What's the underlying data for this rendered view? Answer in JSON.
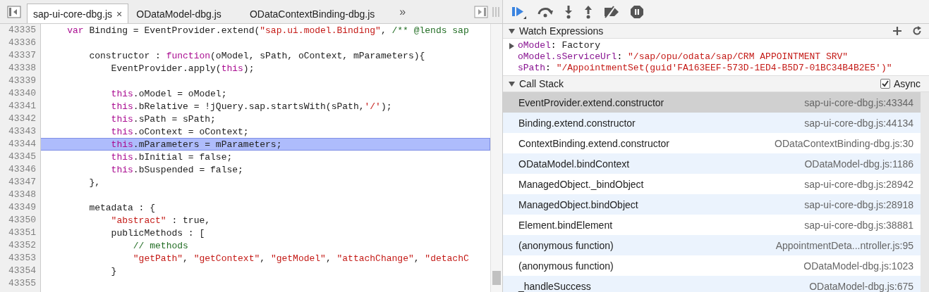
{
  "tabs": [
    {
      "label": "sap-ui-core-dbg.js",
      "selected": true,
      "close": "×"
    },
    {
      "label": "ODataModel-dbg.js",
      "selected": false
    },
    {
      "label": "ODataContextBinding-dbg.js",
      "selected": false
    }
  ],
  "tabs_overflow": "»",
  "code": {
    "lines": [
      {
        "number": "43335",
        "highlighted": false,
        "tokens": [
          {
            "kind": "keyword",
            "text": "    var"
          },
          {
            "kind": "plain",
            "text": " Binding = EventProvider.extend("
          },
          {
            "kind": "string",
            "text": "\"sap.ui.model.Binding\""
          },
          {
            "kind": "plain",
            "text": ", "
          },
          {
            "kind": "comment",
            "text": "/** @lends sap"
          }
        ]
      },
      {
        "number": "43336",
        "highlighted": false
      },
      {
        "number": "43337",
        "highlighted": false,
        "tokens": [
          {
            "kind": "plain",
            "text": "        constructor : "
          },
          {
            "kind": "keyword",
            "text": "function"
          },
          {
            "kind": "plain",
            "text": "(oModel, sPath, oContext, mParameters){"
          }
        ]
      },
      {
        "number": "43338",
        "highlighted": false,
        "tokens": [
          {
            "kind": "plain",
            "text": "            EventProvider.apply("
          },
          {
            "kind": "keyword",
            "text": "this"
          },
          {
            "kind": "plain",
            "text": ");"
          }
        ]
      },
      {
        "number": "43339",
        "highlighted": false
      },
      {
        "number": "43340",
        "highlighted": false,
        "tokens": [
          {
            "kind": "keyword",
            "text": "            this"
          },
          {
            "kind": "plain",
            "text": ".oModel = oModel;"
          }
        ]
      },
      {
        "number": "43341",
        "highlighted": false,
        "tokens": [
          {
            "kind": "keyword",
            "text": "            this"
          },
          {
            "kind": "plain",
            "text": ".bRelative = !jQuery.sap.startsWith(sPath,"
          },
          {
            "kind": "string",
            "text": "'/'"
          },
          {
            "kind": "plain",
            "text": ");"
          }
        ]
      },
      {
        "number": "43342",
        "highlighted": false,
        "tokens": [
          {
            "kind": "keyword",
            "text": "            this"
          },
          {
            "kind": "plain",
            "text": ".sPath = sPath;"
          }
        ]
      },
      {
        "number": "43343",
        "highlighted": false,
        "tokens": [
          {
            "kind": "keyword",
            "text": "            this"
          },
          {
            "kind": "plain",
            "text": ".oContext = oContext;"
          }
        ]
      },
      {
        "number": "43344",
        "highlighted": true,
        "tokens": [
          {
            "kind": "keyword",
            "text": "            this"
          },
          {
            "kind": "plain",
            "text": ".mParameters = mParameters;"
          }
        ]
      },
      {
        "number": "43345",
        "highlighted": false,
        "tokens": [
          {
            "kind": "keyword",
            "text": "            this"
          },
          {
            "kind": "plain",
            "text": ".bInitial = false;"
          }
        ]
      },
      {
        "number": "43346",
        "highlighted": false,
        "tokens": [
          {
            "kind": "keyword",
            "text": "            this"
          },
          {
            "kind": "plain",
            "text": ".bSuspended = false;"
          }
        ]
      },
      {
        "number": "43347",
        "highlighted": false,
        "tokens": [
          {
            "kind": "plain",
            "text": "        },"
          }
        ]
      },
      {
        "number": "43348",
        "highlighted": false
      },
      {
        "number": "43349",
        "highlighted": false,
        "tokens": [
          {
            "kind": "plain",
            "text": "        metadata : {"
          }
        ]
      },
      {
        "number": "43350",
        "highlighted": false,
        "tokens": [
          {
            "kind": "string",
            "text": "            \"abstract\""
          },
          {
            "kind": "plain",
            "text": " : true,"
          }
        ]
      },
      {
        "number": "43351",
        "highlighted": false,
        "tokens": [
          {
            "kind": "plain",
            "text": "            publicMethods : ["
          }
        ]
      },
      {
        "number": "43352",
        "highlighted": false,
        "tokens": [
          {
            "kind": "comment",
            "text": "                // methods"
          }
        ]
      },
      {
        "number": "43353",
        "highlighted": false,
        "tokens": [
          {
            "kind": "string",
            "text": "                \"getPath\""
          },
          {
            "kind": "plain",
            "text": ", "
          },
          {
            "kind": "string",
            "text": "\"getContext\""
          },
          {
            "kind": "plain",
            "text": ", "
          },
          {
            "kind": "string",
            "text": "\"getModel\""
          },
          {
            "kind": "plain",
            "text": ", "
          },
          {
            "kind": "string",
            "text": "\"attachChange\""
          },
          {
            "kind": "plain",
            "text": ", "
          },
          {
            "kind": "string",
            "text": "\"detachC"
          }
        ]
      },
      {
        "number": "43354",
        "highlighted": false,
        "tokens": [
          {
            "kind": "plain",
            "text": "            }"
          }
        ]
      },
      {
        "number": "43355",
        "highlighted": false
      }
    ]
  },
  "watch": {
    "title": "Watch Expressions",
    "expanded": true,
    "items": [
      {
        "name": "oModel",
        "separator": ":",
        "value": "Factory",
        "kind": "object",
        "expanded": false
      },
      {
        "name": "oModel.sServiceUrl",
        "separator": ":",
        "value": "\"/sap/opu/odata/sap/CRM APPOINTMENT SRV\"",
        "kind": "string"
      },
      {
        "name": "sPath",
        "separator": ":",
        "value": "\"/AppointmentSet(guid'FA163EEF-573D-1ED4-B5D7-01BC34B4B2E5')\"",
        "kind": "string"
      }
    ]
  },
  "call_stack": {
    "title": "Call Stack",
    "expanded": true,
    "async": {
      "label": "Async",
      "checked": true
    },
    "frames": [
      {
        "function": "EventProvider.extend.constructor",
        "location": "sap-ui-core-dbg.js:43344",
        "selected": true
      },
      {
        "function": "Binding.extend.constructor",
        "location": "sap-ui-core-dbg.js:44134",
        "selected": false
      },
      {
        "function": "ContextBinding.extend.constructor",
        "location": "ODataContextBinding-dbg.js:30",
        "selected": false
      },
      {
        "function": "ODataModel.bindContext",
        "location": "ODataModel-dbg.js:1186",
        "selected": false
      },
      {
        "function": "ManagedObject._bindObject",
        "location": "sap-ui-core-dbg.js:28942",
        "selected": false
      },
      {
        "function": "ManagedObject.bindObject",
        "location": "sap-ui-core-dbg.js:28918",
        "selected": false
      },
      {
        "function": "Element.bindElement",
        "location": "sap-ui-core-dbg.js:38881",
        "selected": false
      },
      {
        "function": "(anonymous function)",
        "location": "AppointmentDeta...ntroller.js:95",
        "selected": false
      },
      {
        "function": "(anonymous function)",
        "location": "ODataModel-dbg.js:1023",
        "selected": false
      },
      {
        "function": "_handleSuccess",
        "location": "ODataModel-dbg.js:675",
        "selected": false
      }
    ]
  }
}
